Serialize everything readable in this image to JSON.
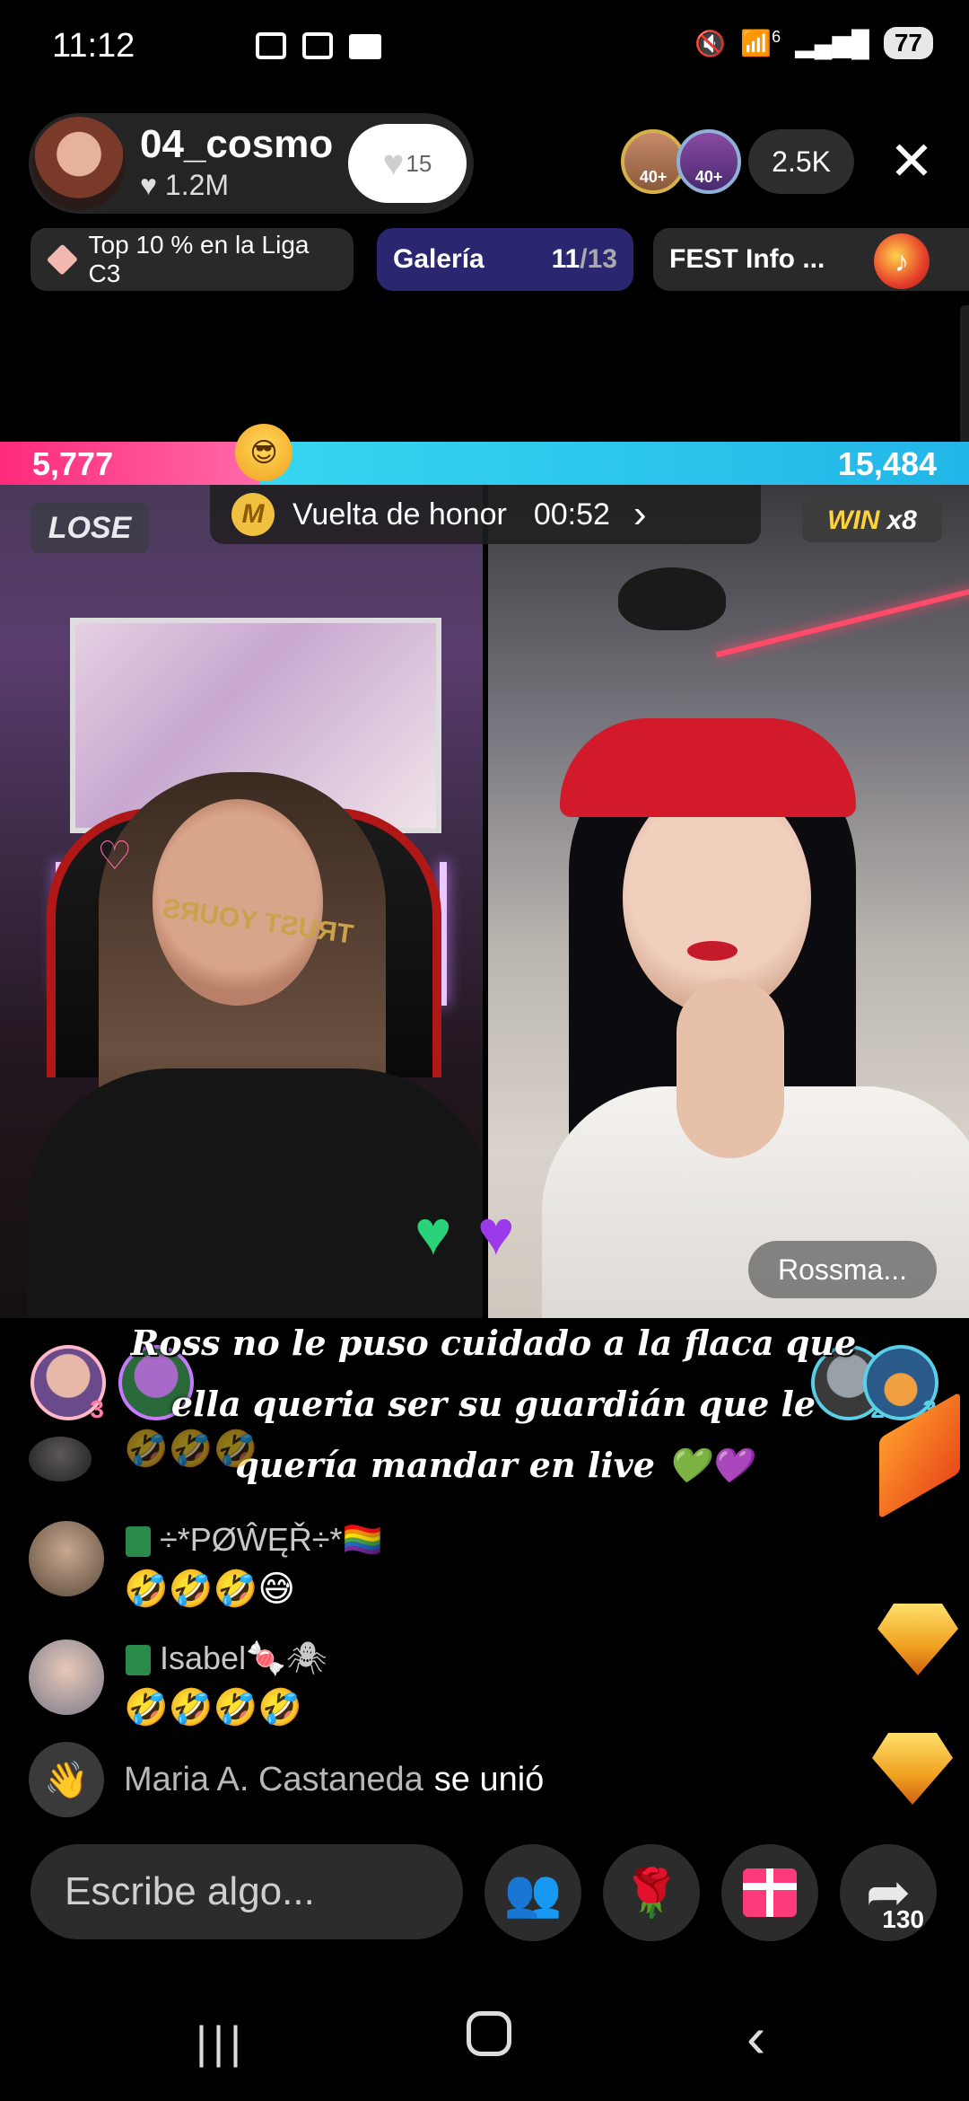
{
  "status_bar": {
    "time": "11:12",
    "signal_label": "6",
    "battery": "77"
  },
  "host": {
    "name": "04_cosmo",
    "likes": "1.2M",
    "follow_count": "15"
  },
  "viewers": {
    "badge_1": "40+",
    "badge_2": "40+",
    "count": "2.5K"
  },
  "info_row": {
    "rank_text": "Top 10 % en la Liga C3",
    "gallery_label": "Galería",
    "gallery_current": "11",
    "gallery_total": "/13",
    "fest_label": "FEST Info ..."
  },
  "battle": {
    "score_left": "5,777",
    "score_right": "15,484",
    "lose_label": "LOSE",
    "win_label": "WIN",
    "win_multiplier": "x8",
    "honor_label": "Vuelta de honor",
    "honor_time": "00:52",
    "guest_name": "Rossma...",
    "shirt_text": "TRUST YOURS"
  },
  "caption": {
    "line1": "Ross no le puso  cuidado  a la flaca que",
    "line2": "ella  queria ser su guardián que le",
    "line3": "quería  mandar  en live 💚💜"
  },
  "gifters": {
    "left_1_rank": "3",
    "right_1_rank": "2",
    "right_2_rank": "3"
  },
  "comments": [
    {
      "name": "",
      "text": "🤣🤣🤣"
    },
    {
      "name": "÷*PØŴĘŘ÷*🏳️‍🌈",
      "text": "🤣🤣🤣😅"
    },
    {
      "name": "Isabel🍬🕷",
      "text": "🤣🤣🤣🤣"
    }
  ],
  "join": {
    "name": "Maria A. Castaneda",
    "action": "se unió"
  },
  "bottom_bar": {
    "input_placeholder": "Escribe algo...",
    "share_count": "130"
  },
  "icons": {
    "close": "close-icon",
    "follow": "heart-icon",
    "rank": "diamond-icon",
    "fest": "music-note-icon",
    "honor": "m-badge-icon",
    "wave": "waving-hand-icon",
    "multi_guest": "people-icon",
    "rose": "rose-icon",
    "gift": "gift-icon",
    "share": "share-arrow-icon"
  },
  "colors": {
    "left_team": "#ff2a7a",
    "right_team": "#38d6f0",
    "gallery_chip": "#2a2670",
    "win_gold": "#ffd23a"
  }
}
